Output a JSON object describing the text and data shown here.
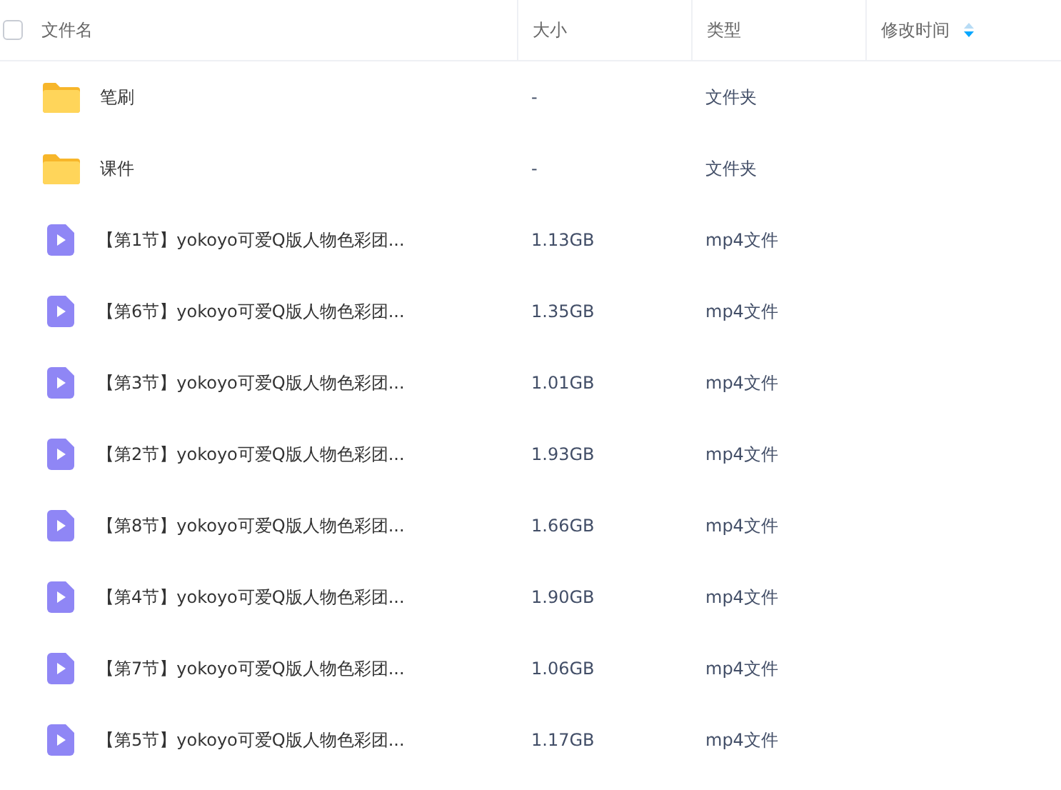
{
  "header": {
    "select_all": {
      "checked": false
    },
    "columns": [
      "文件名",
      "大小",
      "类型",
      "修改时间"
    ]
  },
  "rows": [
    {
      "kind": "folder",
      "name": "笔刷",
      "size": "-",
      "type": "文件夹"
    },
    {
      "kind": "folder",
      "name": "课件",
      "size": "-",
      "type": "文件夹"
    },
    {
      "kind": "video",
      "name": "【第1节】yokoyo可爱Q版人物色彩团...",
      "size": "1.13GB",
      "type": "mp4文件"
    },
    {
      "kind": "video",
      "name": "【第6节】yokoyo可爱Q版人物色彩团...",
      "size": "1.35GB",
      "type": "mp4文件"
    },
    {
      "kind": "video",
      "name": "【第3节】yokoyo可爱Q版人物色彩团...",
      "size": "1.01GB",
      "type": "mp4文件"
    },
    {
      "kind": "video",
      "name": "【第2节】yokoyo可爱Q版人物色彩团...",
      "size": "1.93GB",
      "type": "mp4文件"
    },
    {
      "kind": "video",
      "name": "【第8节】yokoyo可爱Q版人物色彩团...",
      "size": "1.66GB",
      "type": "mp4文件"
    },
    {
      "kind": "video",
      "name": "【第4节】yokoyo可爱Q版人物色彩团...",
      "size": "1.90GB",
      "type": "mp4文件"
    },
    {
      "kind": "video",
      "name": "【第7节】yokoyo可爱Q版人物色彩团...",
      "size": "1.06GB",
      "type": "mp4文件"
    },
    {
      "kind": "video",
      "name": "【第5节】yokoyo可爱Q版人物色彩团...",
      "size": "1.17GB",
      "type": "mp4文件"
    }
  ]
}
